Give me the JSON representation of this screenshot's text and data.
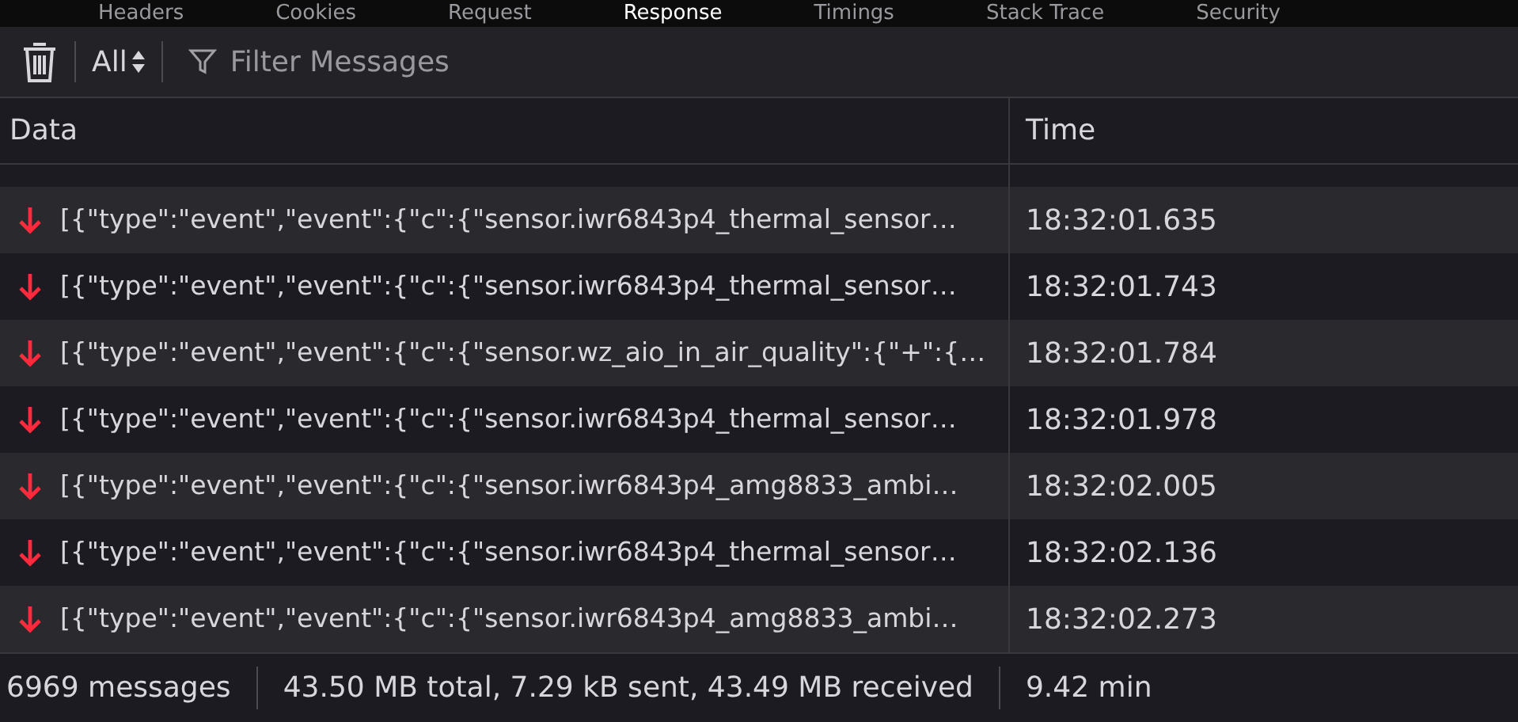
{
  "tabs": [
    {
      "label": "Headers",
      "selected": false
    },
    {
      "label": "Cookies",
      "selected": false
    },
    {
      "label": "Request",
      "selected": false
    },
    {
      "label": "Response",
      "selected": true
    },
    {
      "label": "Timings",
      "selected": false
    },
    {
      "label": "Stack Trace",
      "selected": false
    },
    {
      "label": "Security",
      "selected": false
    }
  ],
  "toolbar": {
    "filter_type": "All",
    "filter_placeholder": "Filter Messages"
  },
  "table": {
    "columns": [
      "Data",
      "Time"
    ],
    "rows": [
      {
        "kind": "received",
        "data": "[{\"type\":\"event\",\"event\":{\"c\":{\"sensor.iwr6843p4_thermal_sensor…",
        "time": "18:32:01.635"
      },
      {
        "kind": "received",
        "data": "[{\"type\":\"event\",\"event\":{\"c\":{\"sensor.iwr6843p4_thermal_sensor…",
        "time": "18:32:01.743"
      },
      {
        "kind": "received",
        "data": "[{\"type\":\"event\",\"event\":{\"c\":{\"sensor.wz_aio_in_air_quality\":{\"+\":{…",
        "time": "18:32:01.784"
      },
      {
        "kind": "received",
        "data": "[{\"type\":\"event\",\"event\":{\"c\":{\"sensor.iwr6843p4_thermal_sensor…",
        "time": "18:32:01.978"
      },
      {
        "kind": "received",
        "data": "[{\"type\":\"event\",\"event\":{\"c\":{\"sensor.iwr6843p4_amg8833_ambi…",
        "time": "18:32:02.005"
      },
      {
        "kind": "received",
        "data": "[{\"type\":\"event\",\"event\":{\"c\":{\"sensor.iwr6843p4_thermal_sensor…",
        "time": "18:32:02.136"
      },
      {
        "kind": "received",
        "data": "[{\"type\":\"event\",\"event\":{\"c\":{\"sensor.iwr6843p4_amg8833_ambi…",
        "time": "18:32:02.273"
      }
    ]
  },
  "status_bar": [
    "6969 messages",
    "43.50 MB total, 7.29 kB sent, 43.49 MB received",
    "9.42 min"
  ]
}
